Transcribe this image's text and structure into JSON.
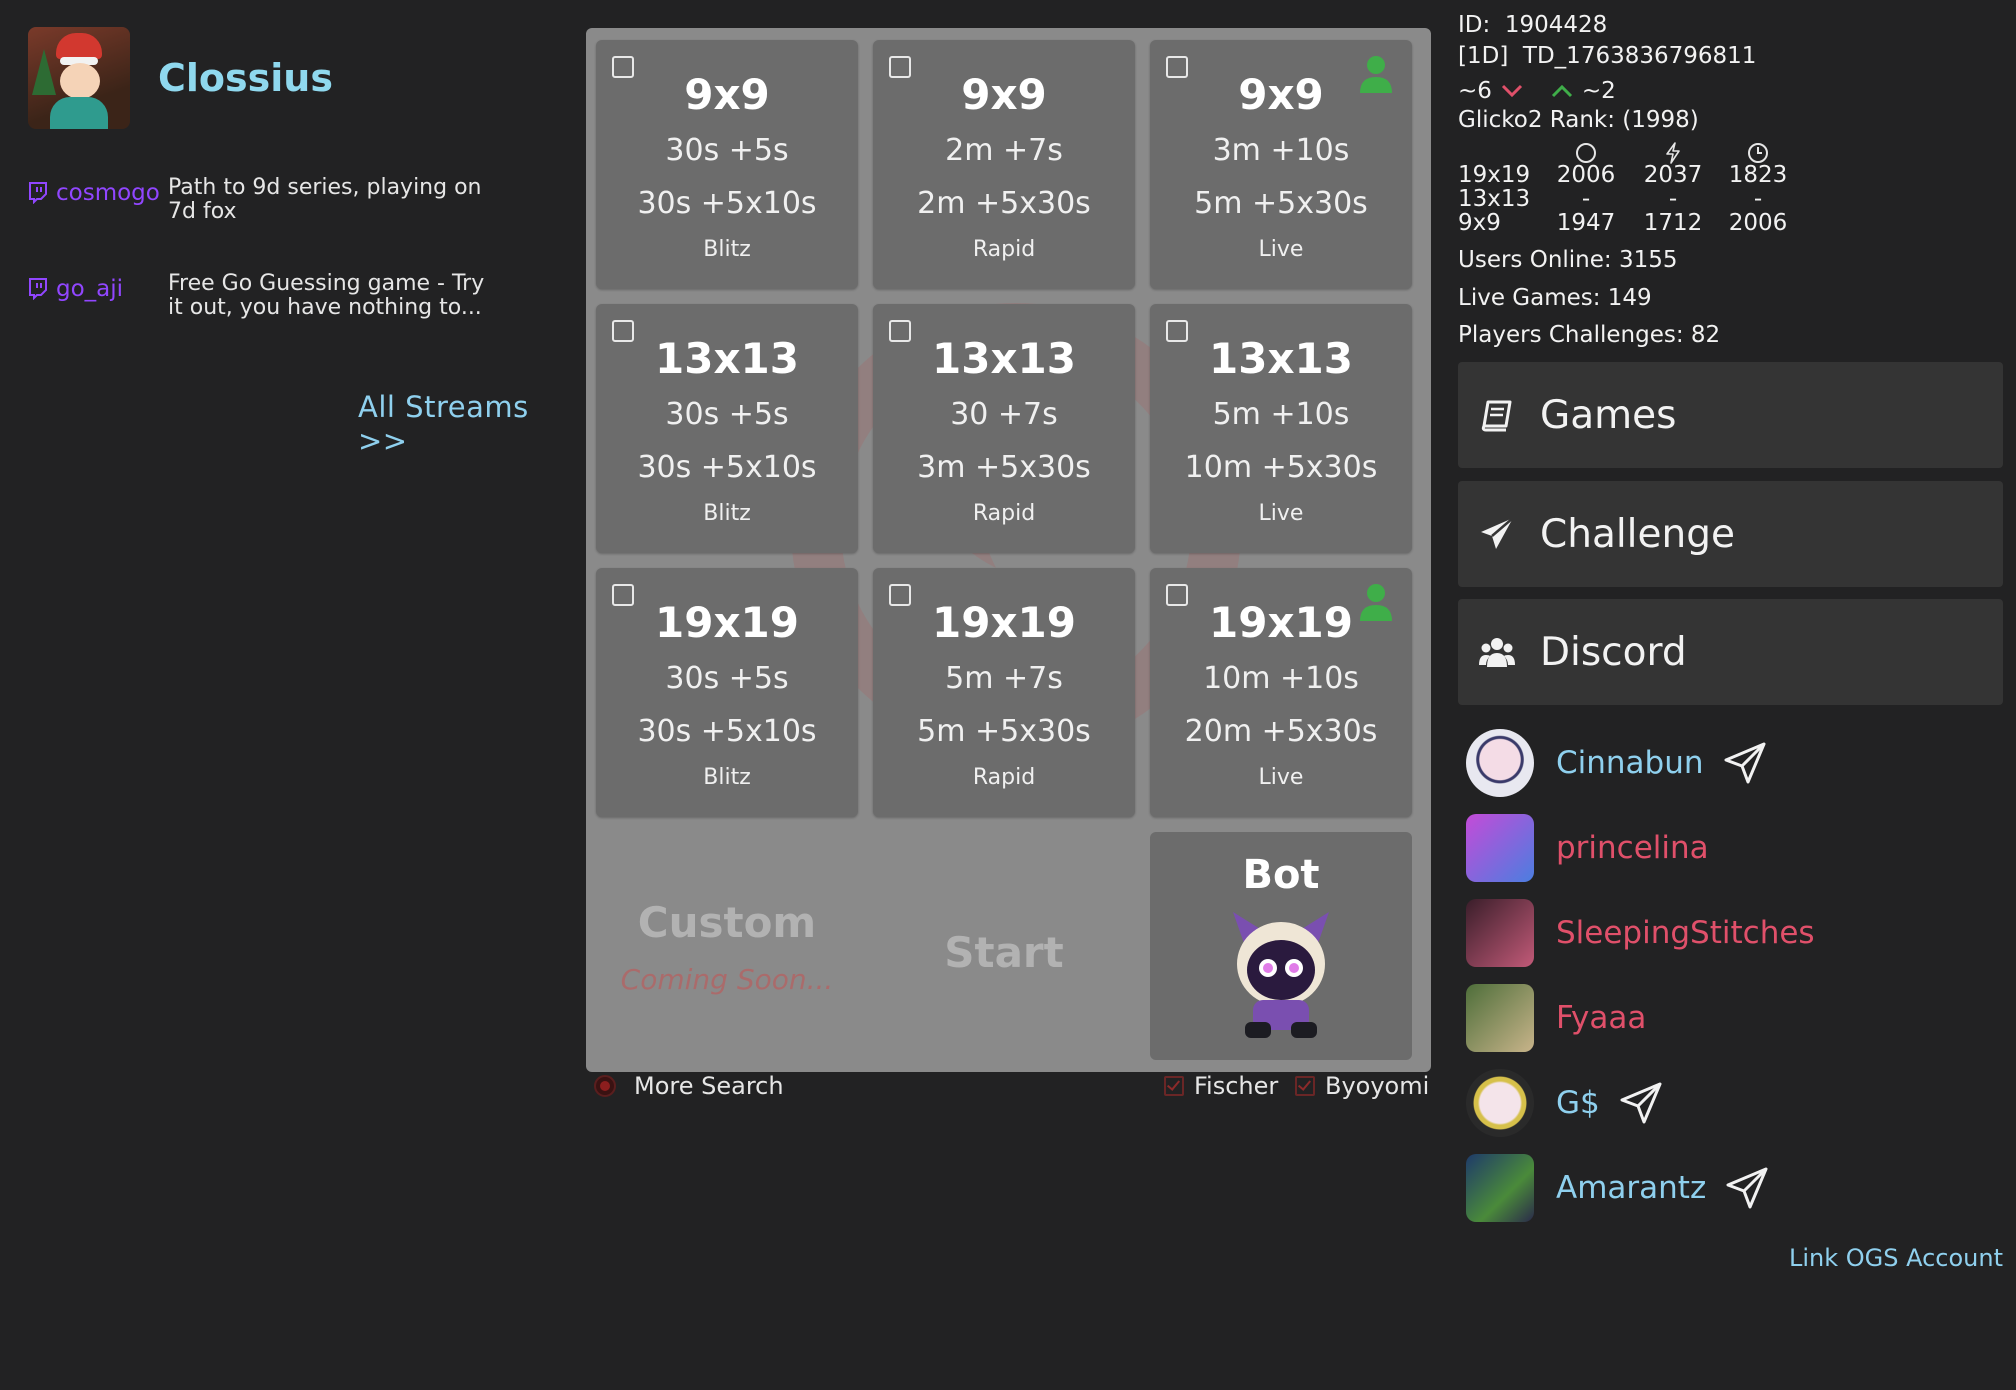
{
  "profile": {
    "name": "Clossius",
    "avatar_icon": "avatar-icon"
  },
  "streams": [
    {
      "user": "cosmogo",
      "title": "Path to 9d series, playing on 7d fox"
    },
    {
      "user": "go_aji",
      "title": "Free Go Guessing game - Try it out, you have nothing to..."
    }
  ],
  "all_streams_label": "All Streams >>",
  "tiles": [
    {
      "size": "9x9",
      "main": "30s +5s",
      "byo": "30s +5x10s",
      "speed": "Blitz",
      "player_online": false
    },
    {
      "size": "9x9",
      "main": "2m +7s",
      "byo": "2m +5x30s",
      "speed": "Rapid",
      "player_online": false
    },
    {
      "size": "9x9",
      "main": "3m +10s",
      "byo": "5m +5x30s",
      "speed": "Live",
      "player_online": true
    },
    {
      "size": "13x13",
      "main": "30s +5s",
      "byo": "30s +5x10s",
      "speed": "Blitz",
      "player_online": false
    },
    {
      "size": "13x13",
      "main": "30 +7s",
      "byo": "3m +5x30s",
      "speed": "Rapid",
      "player_online": false
    },
    {
      "size": "13x13",
      "main": "5m +10s",
      "byo": "10m +5x30s",
      "speed": "Live",
      "player_online": false
    },
    {
      "size": "19x19",
      "main": "30s +5s",
      "byo": "30s +5x10s",
      "speed": "Blitz",
      "player_online": false
    },
    {
      "size": "19x19",
      "main": "5m +7s",
      "byo": "5m +5x30s",
      "speed": "Rapid",
      "player_online": false
    },
    {
      "size": "19x19",
      "main": "10m +10s",
      "byo": "20m +5x30s",
      "speed": "Live",
      "player_online": true
    }
  ],
  "custom": {
    "title": "Custom",
    "subtitle": "Coming Soon..."
  },
  "start_label": "Start",
  "bot_label": "Bot",
  "options": {
    "more_search": "More Search",
    "fischer": "Fischer",
    "byoyomi": "Byoyomi"
  },
  "stats": {
    "id_label": "ID:",
    "id": "1904428",
    "ind_label": "[1D]",
    "ind": "TD_1763836796811",
    "trend_down": "~6",
    "trend_up": "~2",
    "glicko": "Glicko2 Rank: (1998)",
    "board_labels": [
      "19x19",
      "13x13",
      "9x9"
    ],
    "rank_top": [
      "2006",
      "2037",
      "1823"
    ],
    "rank_dash": [
      "-",
      "-",
      "-"
    ],
    "rank_bottom": [
      "1947",
      "1712",
      "2006"
    ],
    "users_online": "Users Online:  3155",
    "live_games": "Live Games:  149",
    "players_challenges": "Players Challenges:  82"
  },
  "menu": {
    "games": "Games",
    "challenge": "Challenge",
    "discord": "Discord"
  },
  "friends": [
    {
      "name": "Cinnabun",
      "color": "#8fd0ee",
      "send": true
    },
    {
      "name": "princelina",
      "color": "#e0506a",
      "send": false
    },
    {
      "name": "SleepingStitches",
      "color": "#e0506a",
      "send": false
    },
    {
      "name": "Fyaaa",
      "color": "#e0506a",
      "send": false
    },
    {
      "name": "G$",
      "color": "#8fd0ee",
      "send": true
    },
    {
      "name": "Amarantz",
      "color": "#8fd0ee",
      "send": true
    }
  ],
  "link_ogs": "Link OGS Account",
  "colors": {
    "accent": "#8fd8ee",
    "twitch": "#9146ff",
    "online": "#3fae49",
    "offline_name": "#e0506a",
    "trend_down": "#e0506a",
    "trend_up": "#3fae49"
  }
}
